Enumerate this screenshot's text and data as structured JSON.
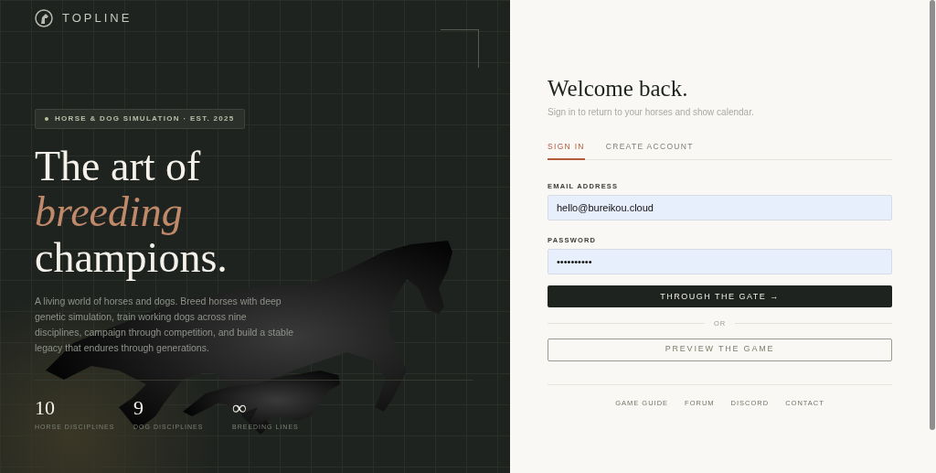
{
  "brand": {
    "name": "TOPLINE"
  },
  "badge": {
    "text": "HORSE & DOG SIMULATION · EST. 2025"
  },
  "headline": {
    "line_1": "The art of",
    "accent": "breeding",
    "line_2": "champions."
  },
  "intro": "A living world of horses and dogs. Breed horses with deep genetic simulation, train working dogs across nine disciplines, campaign through competition, and build a stable legacy that endures through generations.",
  "stats": [
    {
      "value": "10",
      "label": "HORSE DISCIPLINES"
    },
    {
      "value": "9",
      "label": "DOG DISCIPLINES"
    },
    {
      "value": "∞",
      "label": "BREEDING LINES"
    }
  ],
  "form": {
    "title": "Welcome back.",
    "subtitle": "Sign in to return to your horses and show calendar.",
    "tabs": [
      {
        "label": "SIGN IN",
        "selected": true
      },
      {
        "label": "CREATE ACCOUNT",
        "selected": false
      }
    ],
    "fields": [
      {
        "label": "EMAIL ADDRESS",
        "value": "hello@bureikou.cloud"
      },
      {
        "label": "PASSWORD",
        "value": "••••••••••"
      }
    ],
    "submit": "THROUGH THE GATE →",
    "separator": "OR",
    "preview": "PREVIEW THE GAME"
  },
  "footer_links": [
    "GAME GUIDE",
    "FORUM",
    "DISCORD",
    "CONTACT"
  ]
}
